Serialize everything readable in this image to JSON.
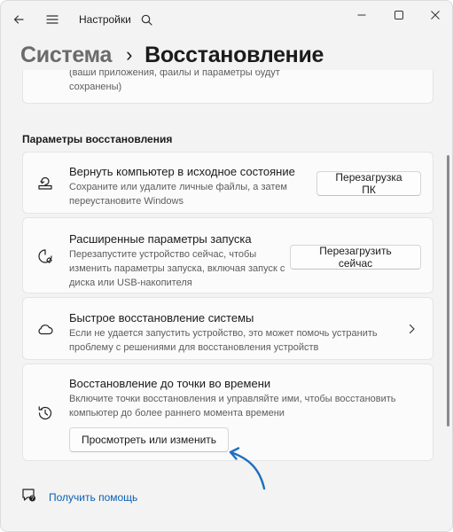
{
  "window": {
    "app_title": "Настройки",
    "icons": {
      "back": "back-arrow-icon",
      "menu": "hamburger-menu-icon",
      "search": "search-icon",
      "minimize": "minimize-icon",
      "maximize": "maximize-icon",
      "close": "close-icon"
    }
  },
  "breadcrumb": {
    "parent": "Система",
    "separator": "›",
    "current": "Восстановление"
  },
  "partial_card": {
    "desc": "(ваши приложения, файлы и параметры будут сохранены)"
  },
  "section": {
    "title": "Параметры восстановления"
  },
  "cards": [
    {
      "icon": "reset-pc-icon",
      "title": "Вернуть компьютер в исходное состояние",
      "desc": "Сохраните или удалите личные файлы, а затем переустановите Windows",
      "button": "Перезагрузка ПК"
    },
    {
      "icon": "advanced-startup-icon",
      "title": "Расширенные параметры запуска",
      "desc": "Перезапустите устройство сейчас, чтобы изменить параметры запуска, включая запуск с диска или USB-накопителя",
      "button": "Перезагрузить сейчас"
    },
    {
      "icon": "cloud-icon",
      "title": "Быстрое восстановление системы",
      "desc": "Если не удается запустить устройство, это может помочь устранить проблему с решениями для восстановления устройств",
      "chevron": "chevron-right-icon"
    },
    {
      "icon": "history-clock-icon",
      "title": "Восстановление до точки во времени",
      "desc": "Включите точки восстановления и управляйте ими, чтобы восстановить компьютер до более раннего момента времени",
      "button": "Просмотреть или изменить"
    }
  ],
  "help": {
    "icon": "help-chat-icon",
    "label": "Получить помощь"
  },
  "colors": {
    "background": "#f3f3f3",
    "card": "#fbfbfb",
    "link": "#0a5fb4",
    "annotation_arrow": "#1f6fbf"
  }
}
